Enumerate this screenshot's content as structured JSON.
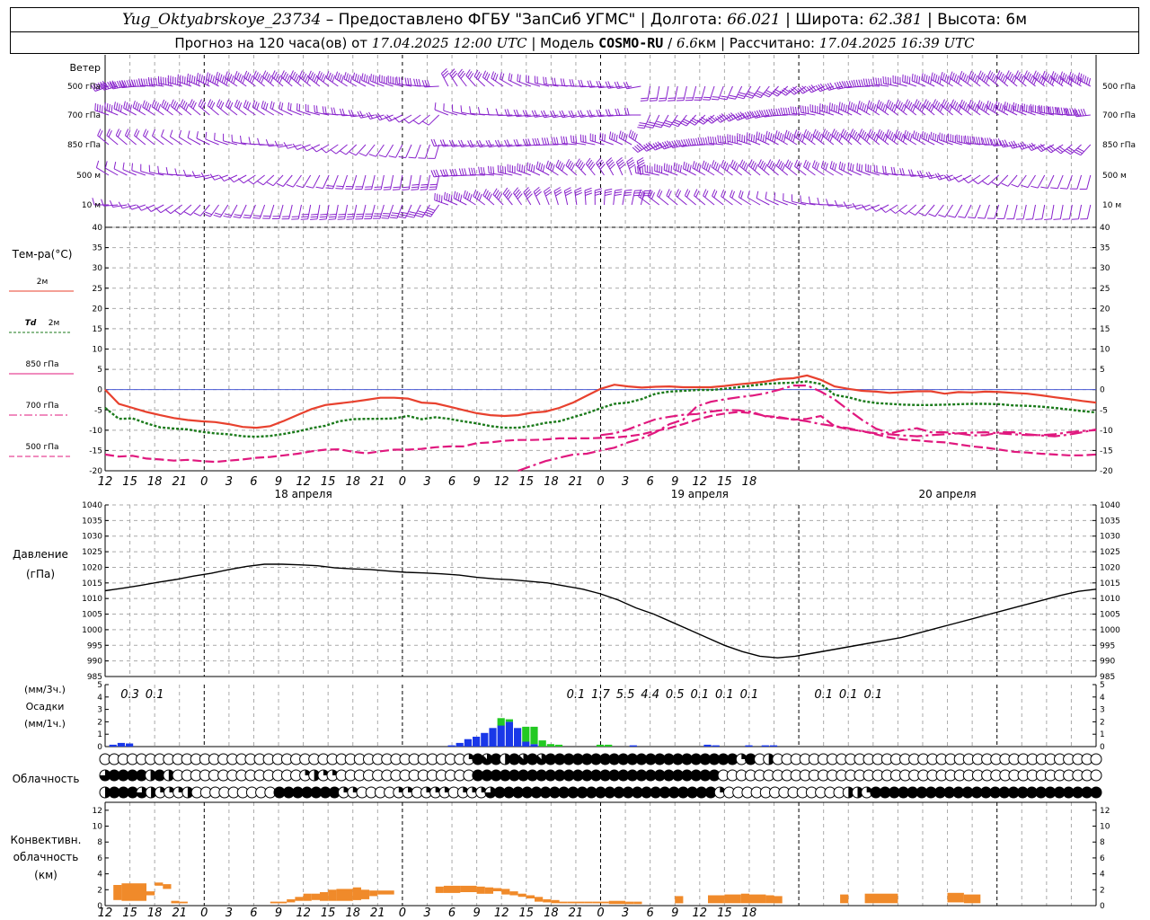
{
  "header": {
    "station": "Yug_Oktyabrskoye_23734",
    "sep1": " – Предоставлено ФГБУ \"ЗапСиб УГМС\" | Долгота: ",
    "lon": "66.021",
    "sep2": " | Широта: ",
    "lat": "62.381",
    "sep3": " | Высота: 6м",
    "l2a": "Прогноз на 120 часа(ов) от ",
    "issued": "17.04.2025 12:00 UTC",
    "l2b": " | Модель ",
    "model": "COSMO-RU",
    "l2c": " / ",
    "res": "6.6",
    "l2d": "км | Рассчитано: ",
    "computed": "17.04.2025 16:39 UTC"
  },
  "labels": {
    "wind": "Ветер",
    "wind_levels": [
      "500 гПа",
      "700 гПа",
      "850 гПа",
      "500 м",
      "10 м"
    ],
    "temp": "Тем-ра(°C)",
    "t2m": "2м",
    "td": "Td",
    "td2": "2м",
    "l850": "850 гПа",
    "l700": "700 гПа",
    "l500": "500 гПа",
    "pressure": "Давление",
    "pressure_unit": "(гПа)",
    "precip_unit1": "(мм/3ч.)",
    "precip": "Осадки",
    "precip_unit2": "(мм/1ч.)",
    "cloud": "Облачность",
    "conv1": "Конвективн.",
    "conv2": "облачность",
    "conv3": "(км)"
  },
  "chart_data": [
    {
      "type": "line",
      "name": "temperature",
      "x_ticks": [
        "12",
        "15",
        "18",
        "21",
        "0",
        "3",
        "6",
        "9",
        "12",
        "15",
        "18",
        "21",
        "0",
        "3",
        "6",
        "9",
        "12",
        "15",
        "18",
        "21",
        "0",
        "3",
        "6",
        "9",
        "12",
        "15",
        "18"
      ],
      "date_labels": [
        "18 апреля",
        "19 апреля",
        "20 апреля"
      ],
      "ylim": [
        -20,
        40
      ],
      "yticks": [
        -20,
        -15,
        -10,
        -5,
        0,
        5,
        10,
        15,
        20,
        25,
        30,
        35,
        40
      ],
      "colors": {
        "t2m": "#e8412e",
        "td2m": "#1a7a1a",
        "t850": "#e0187e",
        "t700": "#e0187e",
        "t500": "#e0187e"
      },
      "series": [
        {
          "key": "t2m",
          "values": [
            0,
            -3.5,
            -4.5,
            -5.5,
            -6.3,
            -7,
            -7.5,
            -7.8,
            -8,
            -8.5,
            -9.2,
            -9.4,
            -9,
            -7.7,
            -6.2,
            -4.8,
            -3.8,
            -3.4,
            -3,
            -2.5,
            -2,
            -2,
            -2.2,
            -3.2,
            -3.4,
            -4.2,
            -5,
            -5.8,
            -6.3,
            -6.5,
            -6.3,
            -5.7,
            -5.4,
            -4.5,
            -3.2,
            -1.5,
            0.2,
            1.2,
            0.8,
            0.5,
            0.7,
            0.8,
            0.6,
            0.6,
            0.6,
            0.9,
            1.3,
            1.6,
            2,
            2.6,
            2.8,
            3.5,
            2.4,
            0.8,
            0.2,
            -0.3,
            -0.5,
            -0.8,
            -0.6,
            -0.4,
            -0.4,
            -1,
            -0.6,
            -0.7,
            -0.5,
            -0.6,
            -0.8,
            -1,
            -1.4,
            -1.9,
            -2.3,
            -2.8,
            -3.2
          ]
        },
        {
          "key": "td2m",
          "values": [
            -4.5,
            -7.2,
            -7.1,
            -8.3,
            -9.3,
            -9.6,
            -9.8,
            -10.4,
            -10.8,
            -11,
            -11.5,
            -11.6,
            -11.4,
            -10.9,
            -10.3,
            -9.5,
            -8.9,
            -7.8,
            -7.3,
            -7.2,
            -7.2,
            -7.1,
            -6.5,
            -7.3,
            -6.8,
            -7.2,
            -7.8,
            -8.3,
            -9,
            -9.4,
            -9.4,
            -8.9,
            -8.2,
            -7.8,
            -6.8,
            -5.8,
            -4.6,
            -3.5,
            -3.2,
            -2.3,
            -1,
            -0.5,
            -0.3,
            -0.1,
            -0.1,
            0.2,
            0.6,
            1,
            1.4,
            1.6,
            1.7,
            2,
            1.4,
            -1.3,
            -1.9,
            -2.8,
            -3.3,
            -3.5,
            -3.7,
            -3.8,
            -3.8,
            -3.7,
            -3.6,
            -3.5,
            -3.5,
            -3.6,
            -3.9,
            -4,
            -4.2,
            -4.5,
            -4.9,
            -5.3,
            -5.6
          ]
        },
        {
          "key": "t850",
          "values": [
            null,
            null,
            null,
            null,
            null,
            null,
            null,
            null,
            null,
            null,
            null,
            null,
            null,
            null,
            null,
            null,
            null,
            null,
            null,
            null,
            null,
            null,
            null,
            null,
            null,
            null,
            null,
            null,
            null,
            null,
            -20,
            -18.8,
            -17.6,
            -16.8,
            -16,
            -15.8,
            -15,
            -14.3,
            -13,
            -12,
            -10.5,
            -8.5,
            -7.4,
            -4.1,
            -3,
            -2.4,
            -1.9,
            -1.5,
            -0.9,
            0,
            1,
            1,
            -0.5,
            -2.4,
            -5,
            -7.5,
            -9.6,
            -10.8,
            -10,
            -9.5,
            -10.5,
            -10.5,
            -10.8,
            -11.3,
            -11.2,
            -10.5,
            -10.5,
            -11,
            -11.3,
            -11.5,
            -11.1,
            -10.5,
            -9.8
          ]
        },
        {
          "key": "t700",
          "values": [
            null,
            null,
            null,
            null,
            null,
            null,
            null,
            null,
            null,
            null,
            null,
            null,
            null,
            null,
            null,
            null,
            null,
            null,
            null,
            null,
            null,
            null,
            null,
            null,
            null,
            null,
            null,
            null,
            null,
            null,
            null,
            null,
            null,
            null,
            null,
            null,
            -11.2,
            -10.8,
            -9.8,
            -8.5,
            -7.3,
            -6.7,
            -6.2,
            -6,
            -5.4,
            -5,
            -5.1,
            -5.5,
            -6.6,
            -7,
            -7.3,
            -7.8,
            -8.5,
            -9,
            -9.5,
            -10.3,
            -10.8,
            -11,
            -11.3,
            -11.5,
            -11.2,
            -11,
            -10.8,
            -10.6,
            -10.5,
            -10.8,
            -11,
            -11.2,
            -11.2,
            -11,
            -10.5,
            -10.2,
            -10
          ]
        },
        {
          "key": "t500",
          "values": [
            -16,
            -16.5,
            -16.3,
            -17,
            -17.2,
            -17.5,
            -17.3,
            -17.6,
            -17.8,
            -17.5,
            -17.2,
            -16.8,
            -16.6,
            -16.2,
            -15.8,
            -15.2,
            -14.8,
            -14.7,
            -15.3,
            -15.7,
            -15.2,
            -14.8,
            -14.8,
            -14.6,
            -14.2,
            -14,
            -14,
            -13.2,
            -13,
            -12.6,
            -12.4,
            -12.4,
            -12.3,
            -12,
            -12,
            -12,
            -11.9,
            -11.8,
            -11.5,
            -11,
            -10.2,
            -9.5,
            -8.5,
            -7.4,
            -6.5,
            -5.9,
            -5.5,
            -5.8,
            -6.5,
            -6.8,
            -7.4,
            -7.2,
            -6.5,
            -9,
            -9.8,
            -10.2,
            -11,
            -11.8,
            -12.3,
            -12.5,
            -12.8,
            -13,
            -13.5,
            -14,
            -14.3,
            -14.8,
            -15.3,
            -15.5,
            -15.8,
            -16,
            -16.2,
            -16.2,
            -16
          ]
        }
      ]
    },
    {
      "type": "line",
      "name": "pressure",
      "ylim": [
        985,
        1040
      ],
      "yticks": [
        985,
        990,
        995,
        1000,
        1005,
        1010,
        1015,
        1020,
        1025,
        1030,
        1035,
        1040
      ],
      "values": [
        1012.5,
        1013.3,
        1014.2,
        1015.2,
        1016.1,
        1017.2,
        1018.1,
        1019.3,
        1020.3,
        1021,
        1021,
        1020.8,
        1020.5,
        1019.8,
        1019.5,
        1019.3,
        1018.8,
        1018.4,
        1018.2,
        1017.9,
        1017.5,
        1016.8,
        1016.3,
        1016,
        1015.5,
        1015,
        1014,
        1013,
        1011.5,
        1009.5,
        1007,
        1005,
        1002.5,
        1000,
        997.5,
        995,
        993,
        991.5,
        991,
        991.5,
        992.5,
        993.5,
        994.5,
        995.5,
        996.5,
        997.5,
        999,
        1000.5,
        1002,
        1003.5,
        1005,
        1006.5,
        1008,
        1009.5,
        1011,
        1012.3,
        1013
      ]
    },
    {
      "type": "bar",
      "name": "precipitation",
      "ylim": [
        0,
        5
      ],
      "yticks": [
        0,
        1,
        2,
        3,
        4,
        5
      ],
      "three_hour_labels": [
        "0.3",
        "0.1",
        "0.1",
        "1.7",
        "5.5",
        "4.4",
        "0.5",
        "0.1",
        "0.1",
        "0.1",
        "0.1",
        "0.1",
        "0.1"
      ],
      "colors": {
        "rain": "#1a38e8",
        "snow": "#22c922"
      },
      "bars": [
        {
          "t": 1,
          "rain": 0.15
        },
        {
          "t": 2,
          "rain": 0.3
        },
        {
          "t": 3,
          "rain": 0.25
        },
        {
          "t": 42,
          "rain": 0.1
        },
        {
          "t": 43,
          "rain": 0.3
        },
        {
          "t": 44,
          "rain": 0.6
        },
        {
          "t": 45,
          "rain": 0.8
        },
        {
          "t": 46,
          "rain": 1.1
        },
        {
          "t": 47,
          "rain": 1.5
        },
        {
          "t": 48,
          "rain": 1.7,
          "snow": 0.6
        },
        {
          "t": 49,
          "rain": 2.0,
          "snow": 0.2
        },
        {
          "t": 50,
          "rain": 1.5,
          "snow": 0.0
        },
        {
          "t": 51,
          "rain": 0.4,
          "snow": 1.2
        },
        {
          "t": 52,
          "rain": 0.2,
          "snow": 1.4
        },
        {
          "t": 53,
          "snow": 0.5
        },
        {
          "t": 54,
          "snow": 0.2
        },
        {
          "t": 55,
          "snow": 0.15
        },
        {
          "t": 60,
          "snow": 0.15
        },
        {
          "t": 61,
          "snow": 0.15
        },
        {
          "t": 64,
          "rain": 0.1
        },
        {
          "t": 73,
          "rain": 0.15
        },
        {
          "t": 74,
          "rain": 0.1
        },
        {
          "t": 78,
          "rain": 0.1
        },
        {
          "t": 80,
          "rain": 0.1
        },
        {
          "t": 81,
          "rain": 0.1
        }
      ]
    },
    {
      "type": "table",
      "name": "cloudiness",
      "rows": [
        "00000000000000000000000000000000000000001F4F2F4F4FFFFFFFFFFFFFFFFFFFFF1F02000000000000000000000000000000000000",
        "3FFFF2F2000000000000001211000000000000000FFFFFFFFFFFFFFFFFFFFFFFFFFF000000000000000000000000000000000000000000",
        "2FFF321112000000000FFFFFFF11000011011101113FFFFFFFFFFFFFFFFFFFFFFFF10000000000000221FFFFFFFFFFFFFFFFFFFFFFFFF"
      ]
    },
    {
      "type": "bar",
      "name": "convective_cloud",
      "ylim": [
        0,
        13
      ],
      "yticks": [
        0,
        2,
        4,
        6,
        8,
        10,
        12
      ],
      "color": "#f08a2a",
      "segments": [
        {
          "from": 1,
          "to": 2,
          "base": 0.7,
          "top": 2.6
        },
        {
          "from": 2,
          "to": 5,
          "base": 0.6,
          "top": 2.8
        },
        {
          "from": 5,
          "to": 6,
          "base": 1.3,
          "top": 1.8
        },
        {
          "from": 6,
          "to": 7,
          "base": 2.5,
          "top": 2.9
        },
        {
          "from": 7,
          "to": 8,
          "base": 2.1,
          "top": 2.7
        },
        {
          "from": 8,
          "to": 9,
          "base": 0.3,
          "top": 0.6
        },
        {
          "from": 9,
          "to": 10,
          "base": 0.3,
          "top": 0.5
        },
        {
          "from": 20,
          "to": 22,
          "base": 0.3,
          "top": 0.5
        },
        {
          "from": 22,
          "to": 23,
          "base": 0.4,
          "top": 0.8
        },
        {
          "from": 23,
          "to": 24,
          "base": 0.6,
          "top": 1.1
        },
        {
          "from": 24,
          "to": 25,
          "base": 0.6,
          "top": 1.5
        },
        {
          "from": 25,
          "to": 26,
          "base": 0.7,
          "top": 1.5
        },
        {
          "from": 26,
          "to": 27,
          "base": 0.6,
          "top": 1.7
        },
        {
          "from": 27,
          "to": 28,
          "base": 0.6,
          "top": 2.0
        },
        {
          "from": 28,
          "to": 30,
          "base": 0.6,
          "top": 2.1
        },
        {
          "from": 30,
          "to": 31,
          "base": 0.7,
          "top": 2.3
        },
        {
          "from": 31,
          "to": 32,
          "base": 0.8,
          "top": 2.0
        },
        {
          "from": 32,
          "to": 33,
          "base": 1.2,
          "top": 1.9
        },
        {
          "from": 33,
          "to": 35,
          "base": 1.4,
          "top": 1.9
        },
        {
          "from": 40,
          "to": 41,
          "base": 1.6,
          "top": 2.4
        },
        {
          "from": 41,
          "to": 43,
          "base": 1.6,
          "top": 2.5
        },
        {
          "from": 43,
          "to": 45,
          "base": 1.7,
          "top": 2.5
        },
        {
          "from": 45,
          "to": 46,
          "base": 1.5,
          "top": 2.4
        },
        {
          "from": 46,
          "to": 47,
          "base": 1.5,
          "top": 2.3
        },
        {
          "from": 47,
          "to": 48,
          "base": 1.8,
          "top": 2.2
        },
        {
          "from": 48,
          "to": 49,
          "base": 1.4,
          "top": 2.1
        },
        {
          "from": 49,
          "to": 50,
          "base": 1.3,
          "top": 1.8
        },
        {
          "from": 50,
          "to": 51,
          "base": 1.1,
          "top": 1.5
        },
        {
          "from": 51,
          "to": 52,
          "base": 0.9,
          "top": 1.3
        },
        {
          "from": 52,
          "to": 53,
          "base": 0.5,
          "top": 1.1
        },
        {
          "from": 53,
          "to": 54,
          "base": 0.4,
          "top": 0.8
        },
        {
          "from": 54,
          "to": 55,
          "base": 0.3,
          "top": 0.7
        },
        {
          "from": 55,
          "to": 56,
          "base": 0.3,
          "top": 0.5
        },
        {
          "from": 56,
          "to": 58,
          "base": 0.3,
          "top": 0.5
        },
        {
          "from": 58,
          "to": 59,
          "base": 0.3,
          "top": 0.5
        },
        {
          "from": 59,
          "to": 61,
          "base": 0.3,
          "top": 0.5
        },
        {
          "from": 61,
          "to": 63,
          "base": 0.2,
          "top": 0.6
        },
        {
          "from": 63,
          "to": 64,
          "base": 0.2,
          "top": 0.5
        },
        {
          "from": 64,
          "to": 65,
          "base": 0.2,
          "top": 0.5
        },
        {
          "from": 69,
          "to": 70,
          "base": 0.3,
          "top": 1.2
        },
        {
          "from": 73,
          "to": 75,
          "base": 0.3,
          "top": 1.3
        },
        {
          "from": 75,
          "to": 77,
          "base": 0.3,
          "top": 1.4
        },
        {
          "from": 77,
          "to": 78,
          "base": 0.3,
          "top": 1.5
        },
        {
          "from": 78,
          "to": 80,
          "base": 0.3,
          "top": 1.4
        },
        {
          "from": 80,
          "to": 81,
          "base": 0.3,
          "top": 1.3
        },
        {
          "from": 81,
          "to": 82,
          "base": 0.3,
          "top": 1.2
        },
        {
          "from": 89,
          "to": 90,
          "base": 0.3,
          "top": 1.4
        },
        {
          "from": 92,
          "to": 96,
          "base": 0.3,
          "top": 1.5
        },
        {
          "from": 102,
          "to": 104,
          "base": 0.4,
          "top": 1.6
        },
        {
          "from": 104,
          "to": 106,
          "base": 0.3,
          "top": 1.4
        }
      ]
    }
  ],
  "colors": {
    "wind": "#8822cc",
    "grid": "#a9a9a9",
    "zero": "#4c5bd6"
  }
}
